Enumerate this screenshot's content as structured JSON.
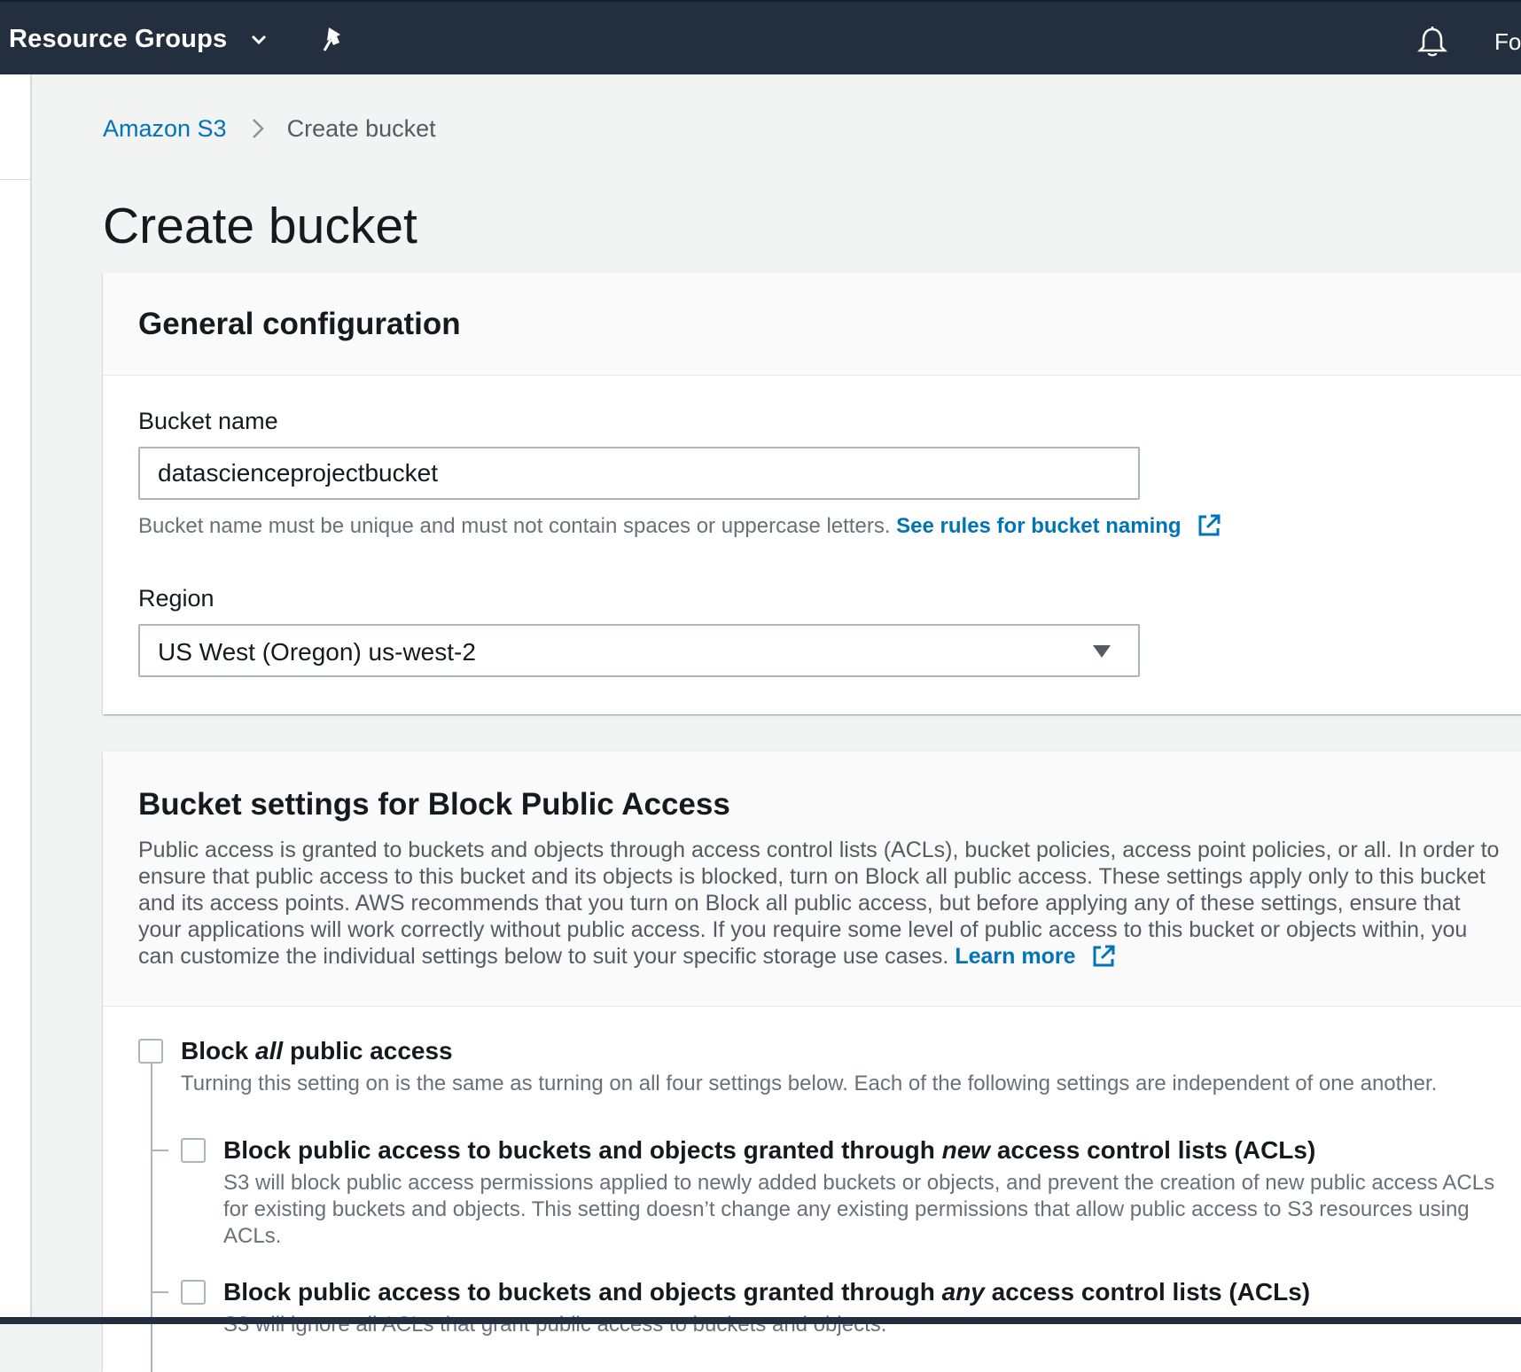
{
  "topnav": {
    "resource_groups": "Resource Groups",
    "account_truncated": "Fo"
  },
  "breadcrumb": {
    "root": "Amazon S3",
    "current": "Create bucket"
  },
  "page": {
    "title": "Create bucket"
  },
  "general_config": {
    "title": "General configuration",
    "bucket_name_label": "Bucket name",
    "bucket_name_value": "datascienceprojectbucket",
    "bucket_name_hint": "Bucket name must be unique and must not contain spaces or uppercase letters.",
    "bucket_name_link": "See rules for bucket naming",
    "region_label": "Region",
    "region_value": "US West (Oregon) us-west-2"
  },
  "block_public_access": {
    "title": "Bucket settings for Block Public Access",
    "description": "Public access is granted to buckets and objects through access control lists (ACLs), bucket policies, access point policies, or all. In order to ensure that public access to this bucket and its objects is blocked, turn on Block all public access. These settings apply only to this bucket and its access points. AWS recommends that you turn on Block all public access, but before applying any of these settings, ensure that your applications will work correctly without public access. If you require some level of public access to this bucket or objects within, you can customize the individual settings below to suit your specific storage use cases.",
    "learn_more": "Learn more",
    "block_all": {
      "title_prefix": "Block ",
      "title_em": "all",
      "title_suffix": " public access",
      "description": "Turning this setting on is the same as turning on all four settings below. Each of the following settings are independent of one another.",
      "checked": false
    },
    "options": [
      {
        "title_prefix": "Block public access to buckets and objects granted through ",
        "title_em": "new",
        "title_suffix": " access control lists (ACLs)",
        "description": "S3 will block public access permissions applied to newly added buckets or objects, and prevent the creation of new public access ACLs for existing buckets and objects. This setting doesn’t change any existing permissions that allow public access to S3 resources using ACLs.",
        "checked": false
      },
      {
        "title_prefix": "Block public access to buckets and objects granted through ",
        "title_em": "any",
        "title_suffix": " access control lists (ACLs)",
        "description": "S3 will ignore all ACLs that grant public access to buckets and objects.",
        "checked": false
      }
    ]
  },
  "colors": {
    "nav_bg": "#232f3e",
    "link": "#0073bb",
    "page_bg": "#f2f3f3"
  }
}
